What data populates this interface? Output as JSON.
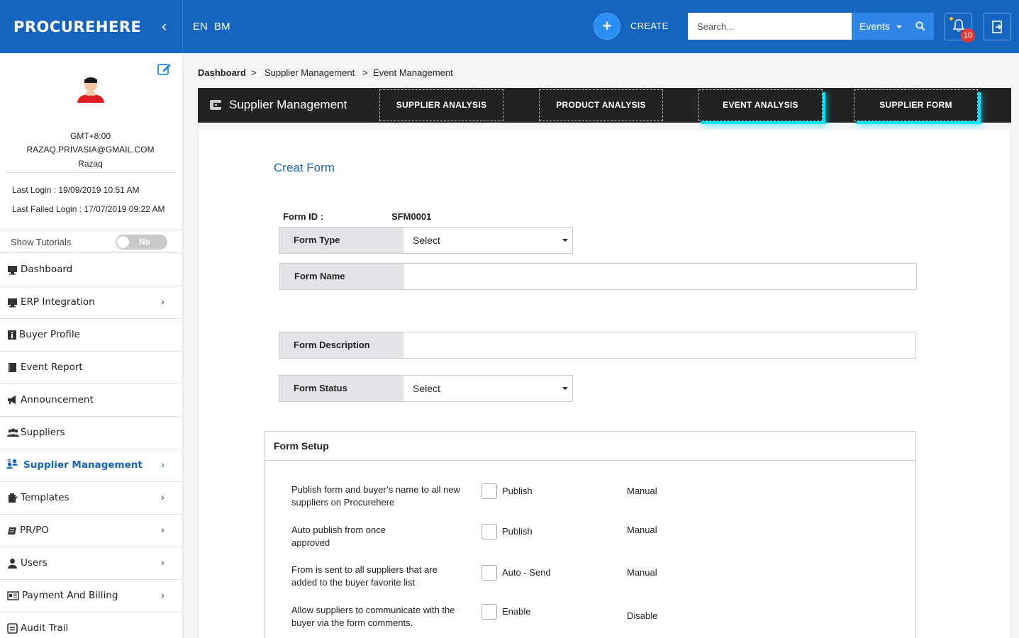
{
  "app": {
    "brand": "PROCUREHERE",
    "languages": [
      "EN",
      "BM"
    ],
    "create_label": "CREATE",
    "search_placeholder": "Search...",
    "search_scope": "Events",
    "notification_count": "10"
  },
  "profile": {
    "timezone": "GMT+8:00",
    "email": "RAZAQ.PRIVASIA@GMAIL.COM",
    "name": "Razaq",
    "last_login": "Last Login : 19/09/2019 10:51 AM",
    "last_failed_login": "Last Failed Login : 17/07/2019 09:22 AM",
    "tutorials_label": "Show Tutorials",
    "tutorials_state": "No"
  },
  "sidebar": {
    "items": [
      {
        "label": "Dashboard",
        "icon": "monitor-icon",
        "chevron": false
      },
      {
        "label": "ERP Integration",
        "icon": "monitor-icon",
        "chevron": true
      },
      {
        "label": "Buyer Profile",
        "icon": "info-icon",
        "chevron": false
      },
      {
        "label": "Event Report",
        "icon": "book-icon",
        "chevron": false
      },
      {
        "label": "Announcement",
        "icon": "megaphone-icon",
        "chevron": false
      },
      {
        "label": "Suppliers",
        "icon": "users-icon",
        "chevron": false
      },
      {
        "label": "Supplier Management",
        "icon": "supplier-management-icon",
        "chevron": true,
        "active": true
      },
      {
        "label": "Templates",
        "icon": "templates-icon",
        "chevron": true
      },
      {
        "label": "PR/PO",
        "icon": "document-icon",
        "chevron": true
      },
      {
        "label": "Users",
        "icon": "user-icon",
        "chevron": true
      },
      {
        "label": "Payment And Billing",
        "icon": "billing-icon",
        "chevron": true
      },
      {
        "label": "Audit Trail",
        "icon": "audit-icon",
        "chevron": false
      }
    ]
  },
  "breadcrumb": {
    "items": [
      "Dashboard",
      "Supplier Management",
      "Event Management"
    ],
    "separator": ">"
  },
  "module": {
    "title": "Supplier Management",
    "tabs": [
      "SUPPLIER ANALYSIS",
      "PRODUCT ANALYSIS",
      "EVENT ANALYSIS",
      "SUPPLIER FORM"
    ]
  },
  "form": {
    "title": "Creat Form",
    "form_id_label": "Form ID :",
    "form_id_value": "SFM0001",
    "type_label": "Form Type",
    "type_value": "Select",
    "name_label": "Form Name",
    "name_value": "",
    "description_label": "Form Description",
    "description_value": "",
    "status_label": "Form Status",
    "status_value": "Select"
  },
  "setup": {
    "title": "Form Setup",
    "options": [
      {
        "text": "Publish form and buyer’s name to all new suppliers on Procurehere",
        "check_label": "Publish",
        "mode": "Manual"
      },
      {
        "text": "Auto publish from once approved",
        "check_label": "Publish",
        "mode": "Manual"
      },
      {
        "text": "From is sent to all suppliers that are added to the buyer favorite list",
        "check_label": "Auto - Send",
        "mode": "Manual"
      },
      {
        "text": "Allow suppliers to communicate with the buyer via the form comments.",
        "check_label": "Enable",
        "mode": "Disable"
      }
    ]
  },
  "colors": {
    "primary": "#1565c0",
    "tabbar": "#222222",
    "tab_glow": "#00e5ff",
    "badge": "#e53935"
  }
}
